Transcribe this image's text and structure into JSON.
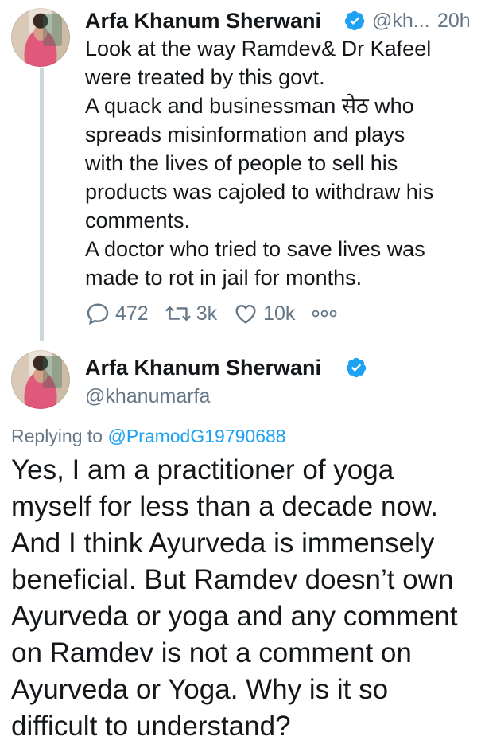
{
  "tweet1": {
    "author_name": "Arfa Khanum Sherwani",
    "handle": "@kh...",
    "time": "20h",
    "text": "Look at the way Ramdev& Dr Kafeel\nwere treated by this govt.\nA quack and businessman सेठ who\nspreads misinformation and plays\nwith the lives of people to sell his\nproducts was cajoled to withdraw his\ncomments.\nA doctor who tried to save lives was\nmade to rot in jail for months.",
    "reply_count": "472",
    "retweet_count": "3k",
    "like_count": "10k",
    "icons": {
      "reply": "reply-icon",
      "retweet": "retweet-icon",
      "like": "like-icon",
      "more": "more-icon",
      "verified": "verified-icon"
    }
  },
  "tweet2": {
    "author_name": "Arfa Khanum Sherwani",
    "handle": "@khanumarfa",
    "replying_prefix": "Replying to",
    "replying_to": "@PramodG19790688",
    "text": "Yes, I am a practitioner of yoga\nmyself for less than a decade now.\nAnd I think Ayurveda is immensely\nbeneficial. But Ramdev doesn’t own\nAyurveda or yoga and any comment\non Ramdev is not a comment on\nAyurveda or Yoga. Why is it so\ndifficult to understand?"
  },
  "colors": {
    "link": "#1da1f2",
    "muted": "#657786",
    "text": "#14171a",
    "thread_line": "#ccd6dd"
  }
}
